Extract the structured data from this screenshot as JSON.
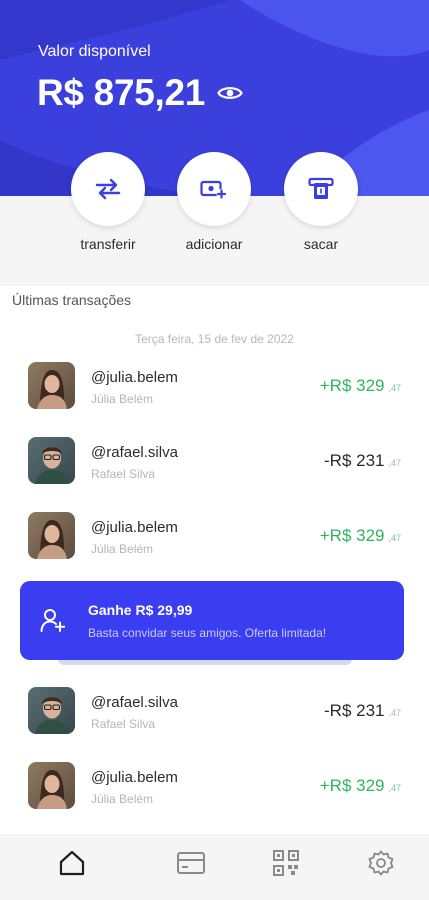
{
  "balance": {
    "label": "Valor disponível",
    "value": "R$ 875,21",
    "visibility_icon": "eye-icon"
  },
  "actions": [
    {
      "label": "transferir",
      "icon": "transfer-arrows-icon"
    },
    {
      "label": "adicionar",
      "icon": "add-money-icon"
    },
    {
      "label": "sacar",
      "icon": "atm-withdraw-icon"
    }
  ],
  "transactions_section": {
    "title": "Últimas transações",
    "date": "Terça feira, 15 de fev de 2022"
  },
  "transactions": [
    {
      "handle": "@julia.belem",
      "name": "Júlia Belém",
      "amount": "+R$ 329",
      "cents": ",47",
      "type": "credit"
    },
    {
      "handle": "@rafael.silva",
      "name": "Rafael Silva",
      "amount": "-R$ 231",
      "cents": ",47",
      "type": "debit"
    },
    {
      "handle": "@julia.belem",
      "name": "Júlia Belém",
      "amount": "+R$ 329",
      "cents": ",47",
      "type": "credit"
    },
    {
      "handle": "@rafael.silva",
      "name": "Rafael Silva",
      "amount": "-R$ 231",
      "cents": ",47",
      "type": "debit"
    },
    {
      "handle": "@julia.belem",
      "name": "Júlia Belém",
      "amount": "+R$ 329",
      "cents": ",47",
      "type": "credit"
    }
  ],
  "promo": {
    "title": "Ganhe R$ 29,99",
    "subtitle": "Basta convidar seus amigos. Oferta limitada!",
    "icon": "add-user-icon"
  },
  "bottom_nav": [
    {
      "icon": "home-icon",
      "active": true
    },
    {
      "icon": "card-icon",
      "active": false
    },
    {
      "icon": "qr-code-icon",
      "active": false
    },
    {
      "icon": "settings-gear-icon",
      "active": false
    }
  ],
  "colors": {
    "primary": "#3a3fe0",
    "credit": "#2fb55c",
    "muted": "#b5b5b5"
  }
}
